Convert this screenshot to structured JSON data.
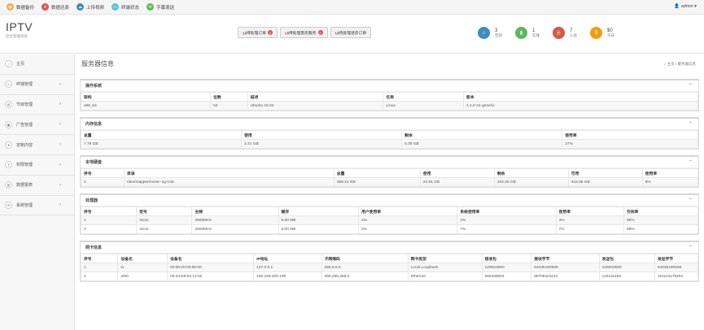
{
  "topbar": {
    "items": [
      {
        "label": "数据备份",
        "icon": "database-icon",
        "color": "#f0ad4e"
      },
      {
        "label": "数据还原",
        "icon": "restore-icon",
        "color": "#d9534f"
      },
      {
        "label": "上传视频",
        "icon": "upload-icon",
        "color": "#3c8dbc"
      },
      {
        "label": "终端状态",
        "icon": "monitor-icon",
        "color": "#5bc0de"
      },
      {
        "label": "字幕滚送",
        "icon": "chat-icon",
        "color": "#5cb85c"
      }
    ],
    "user": "admin"
  },
  "brand": {
    "title": "IPTV",
    "subtitle": "后台管理系统"
  },
  "header_buttons": [
    {
      "label": "待处理订单",
      "badge": "0"
    },
    {
      "label": "待处理客房服务",
      "badge": "0"
    },
    {
      "label": "待处理退房订单",
      "badge": ""
    }
  ],
  "stats": [
    {
      "value": "3",
      "label": "空闲",
      "icon": "home-icon",
      "color": "#3c8dbc"
    },
    {
      "value": "1",
      "label": "在线",
      "icon": "signal-icon",
      "color": "#5cb85c"
    },
    {
      "value": "7",
      "label": "入住",
      "icon": "lock-icon",
      "color": "#d9534f"
    },
    {
      "value": "$0",
      "label": "今日",
      "icon": "money-icon",
      "color": "#f39c12"
    }
  ],
  "sidebar": {
    "items": [
      {
        "label": "主页",
        "icon": "home-icon",
        "arrow": false
      },
      {
        "label": "终端管理",
        "icon": "monitor-icon",
        "arrow": true
      },
      {
        "label": "节目管理",
        "icon": "film-icon",
        "arrow": true
      },
      {
        "label": "广告管理",
        "icon": "image-icon",
        "arrow": true
      },
      {
        "label": "定制内容",
        "icon": "star-icon",
        "arrow": true
      },
      {
        "label": "权限管理",
        "icon": "key-icon",
        "arrow": true
      },
      {
        "label": "数据报表",
        "icon": "chart-icon",
        "arrow": true
      },
      {
        "label": "系统管理",
        "icon": "gear-icon",
        "arrow": true
      }
    ]
  },
  "page": {
    "title": "服务器信息",
    "breadcrumb_home": "主页",
    "breadcrumb_current": "服务器信息"
  },
  "sections": [
    {
      "title": "操作系统",
      "widths": [
        21,
        6,
        22,
        13,
        38
      ],
      "headers": [
        "架构",
        "位数",
        "描述",
        "名称",
        "版本"
      ],
      "rows": [
        [
          "x86_64",
          "64",
          "Ubuntu 16.04",
          "Linux",
          "4.4.0-31-generic"
        ]
      ]
    },
    {
      "title": "内存信息",
      "widths": [
        26,
        26,
        26,
        22
      ],
      "headers": [
        "总量",
        "使用",
        "剩余",
        "使用率"
      ],
      "rows": [
        [
          "7.79 GB",
          "2.41 GB",
          "5.38 GB",
          "27%"
        ]
      ]
    },
    {
      "title": "本地硬盘",
      "widths": [
        7,
        34,
        14,
        12,
        12,
        12,
        9
      ],
      "headers": [
        "序号",
        "目录",
        "总量",
        "使用",
        "剩余",
        "可用",
        "使用率"
      ],
      "rows": [
        [
          "1",
          "/dev/mapper/msse--vg-root",
          "358.21 GB",
          "24.91 GB",
          "333.30 GB",
          "315.08 GB",
          "8%"
        ]
      ]
    },
    {
      "title": "处理器",
      "widths": [
        9,
        9,
        14,
        13,
        16,
        16,
        11,
        12
      ],
      "headers": [
        "序号",
        "型号",
        "主频",
        "缓存",
        "用户使用率",
        "系统使用率",
        "使用率",
        "空闲率"
      ],
      "rows": [
        [
          "1",
          "Xeon",
          "2500MHz",
          "6.00 MB",
          "2%",
          "2%",
          "4%",
          "95%"
        ],
        [
          "2",
          "Xeon",
          "2500MHz",
          "6.00 MB",
          "0%",
          "7%",
          "7%",
          "88%"
        ]
      ]
    },
    {
      "title": "网卡信息",
      "widths": [
        6,
        8,
        14,
        11,
        14,
        12,
        8,
        11,
        9,
        8
      ],
      "headers": [
        "序号",
        "设备名",
        "设备名",
        "IP地址",
        "子网掩码",
        "网卡类型",
        "接收包",
        "接收字节",
        "发送包",
        "发送字节"
      ],
      "rows": [
        [
          "1",
          "lo",
          "00:00:00:00:00:00",
          "127.0.0.1",
          "255.0.0.0",
          "Local Loopback",
          "126633650",
          "64036190508",
          "126633650",
          "64036190508"
        ],
        [
          "2",
          "eth0",
          "00:24:E8:54:12:02",
          "192.168.200.199",
          "255.255.255.0",
          "Ethernet",
          "555338004",
          "88708101122",
          "119115163",
          "161101179284"
        ]
      ]
    }
  ]
}
